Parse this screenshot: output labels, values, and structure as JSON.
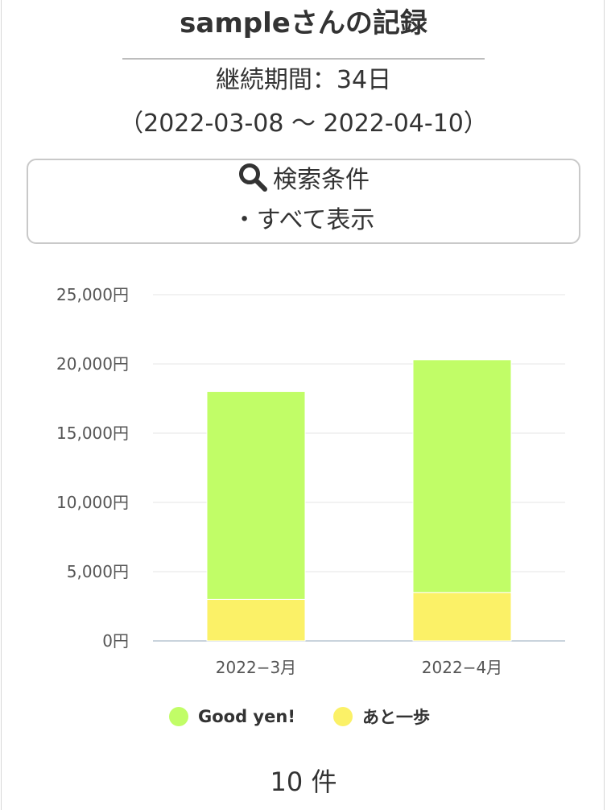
{
  "header": {
    "title": "sampleさんの記録",
    "period": "継続期間：34日",
    "range": "（2022-03-08 〜 2022-04-10）"
  },
  "search": {
    "icon": "search-icon",
    "label": "検索条件",
    "condition": "・すべて表示"
  },
  "chart_data": {
    "type": "bar",
    "stacked": true,
    "categories": [
      "2022−3月",
      "2022−4月"
    ],
    "series": [
      {
        "name": "あと一歩",
        "values": [
          3000,
          3500
        ],
        "color": "#fbf167"
      },
      {
        "name": "Good yen!",
        "values": [
          15000,
          16800
        ],
        "color": "#c1fd67"
      }
    ],
    "ylim": [
      0,
      25000
    ],
    "yticks": [
      "0円",
      "5,000円",
      "10,000円",
      "15,000円",
      "20,000円",
      "25,000円"
    ],
    "grid": true,
    "legend": "bottom"
  },
  "legend": {
    "items": [
      {
        "label": "Good yen!",
        "color": "#c1fd67"
      },
      {
        "label": "あと一歩",
        "color": "#fbf167"
      }
    ]
  },
  "footer": {
    "count": "10 件"
  }
}
